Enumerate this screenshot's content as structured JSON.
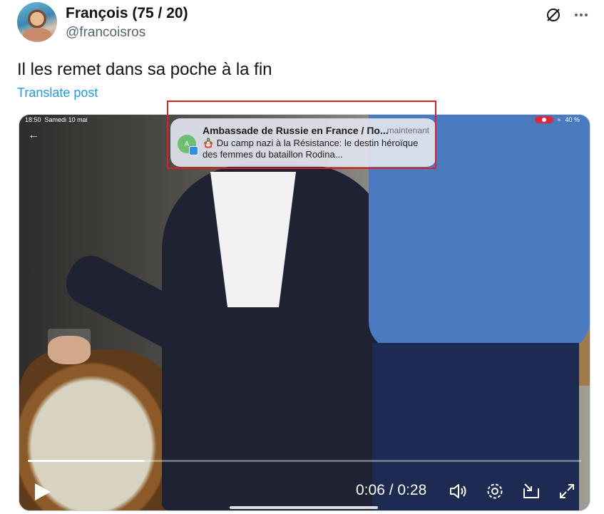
{
  "post": {
    "author_name": "François (75 / 20)",
    "author_handle": "@francoisros",
    "text": "Il les remet dans sa poche à la fin",
    "translate_label": "Translate post"
  },
  "video": {
    "status_time": "18:50",
    "status_date": "Samedi 10 mai",
    "status_battery": "40 %",
    "notification": {
      "app_initial": "A",
      "title": "Ambassade de Russie en France / По...",
      "time": "maintenant",
      "body": "🪆 Du camp nazi à la Résistance: le destin héroïque des femmes du bataillon Rodina..."
    },
    "current_time": "0:06",
    "separator": "/",
    "duration": "0:28",
    "progress_fraction": 0.21
  },
  "colors": {
    "accent": "#1d9bf0",
    "highlight_box": "#e02020"
  },
  "icons": [
    "grok-icon",
    "more-icon",
    "back-arrow-icon",
    "play-icon",
    "volume-icon",
    "settings-icon",
    "dock-icon",
    "fullscreen-icon"
  ]
}
